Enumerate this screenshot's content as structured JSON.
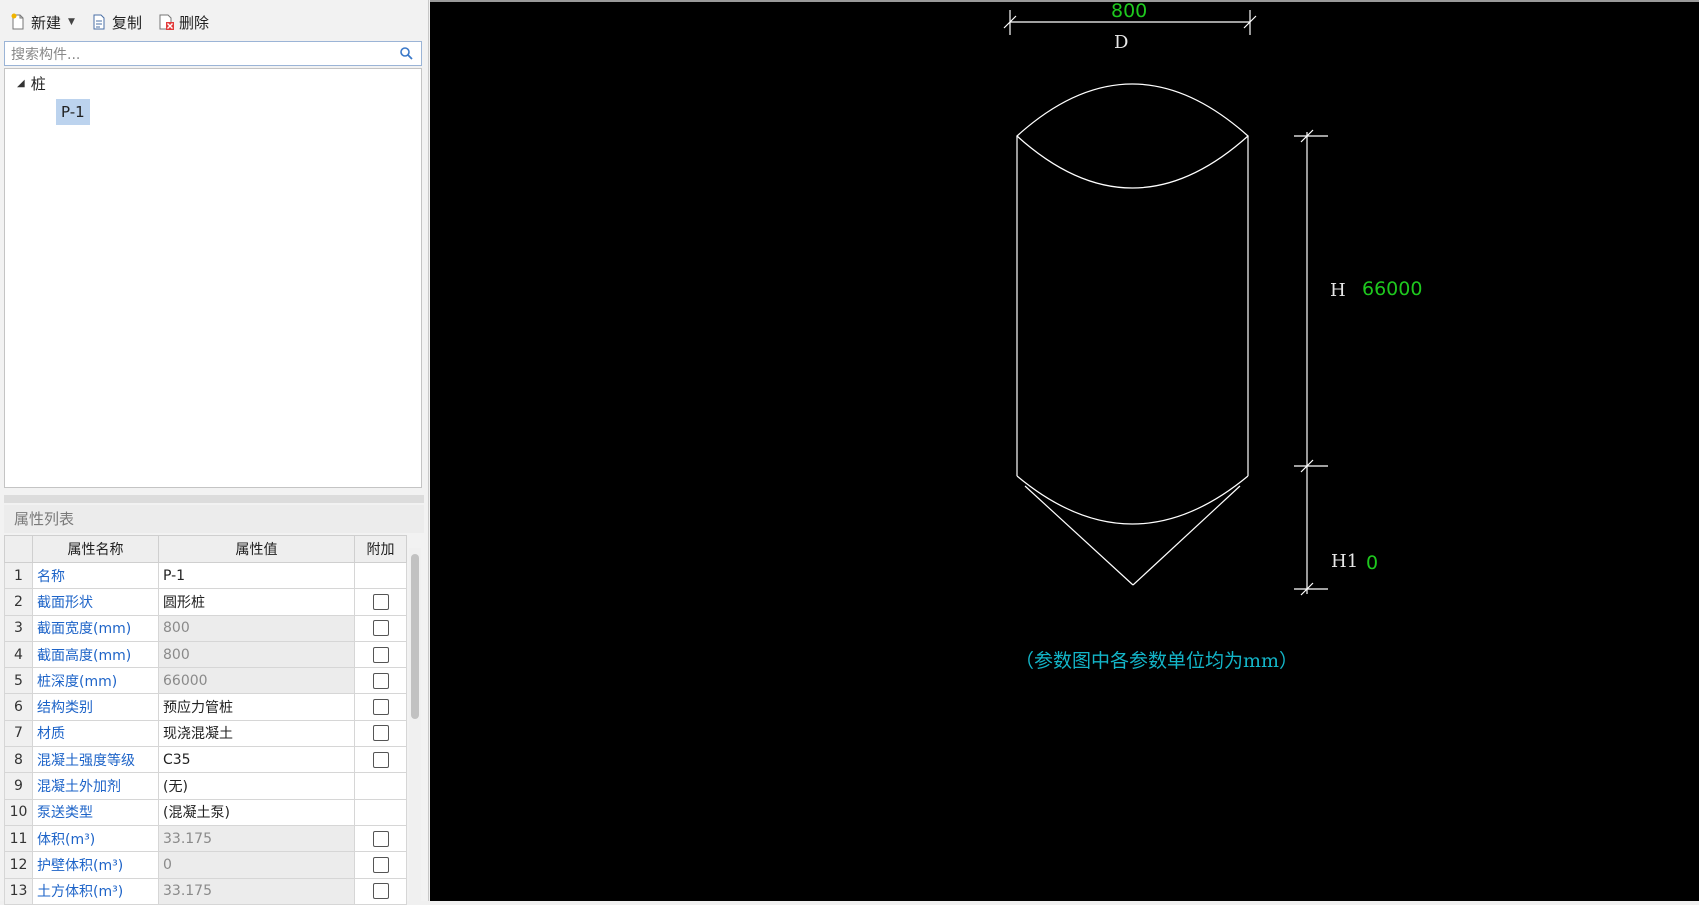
{
  "toolbar": {
    "new_label": "新建",
    "copy_label": "复制",
    "delete_label": "删除"
  },
  "search": {
    "placeholder": "搜索构件..."
  },
  "tree": {
    "root_label": "桩",
    "child_label": "P-1"
  },
  "properties": {
    "title": "属性列表",
    "columns": [
      "",
      "属性名称",
      "属性值",
      "附加"
    ],
    "rows": [
      {
        "index": "1",
        "name": "名称",
        "value": "P-1",
        "editable": true,
        "has_checkbox": false
      },
      {
        "index": "2",
        "name": "截面形状",
        "value": "圆形桩",
        "editable": true,
        "has_checkbox": true
      },
      {
        "index": "3",
        "name": "截面宽度(mm)",
        "value": "800",
        "editable": false,
        "has_checkbox": true
      },
      {
        "index": "4",
        "name": "截面高度(mm)",
        "value": "800",
        "editable": false,
        "has_checkbox": true
      },
      {
        "index": "5",
        "name": "桩深度(mm)",
        "value": "66000",
        "editable": false,
        "has_checkbox": true
      },
      {
        "index": "6",
        "name": "结构类别",
        "value": "预应力管桩",
        "editable": true,
        "has_checkbox": true
      },
      {
        "index": "7",
        "name": "材质",
        "value": "现浇混凝土",
        "editable": true,
        "has_checkbox": true
      },
      {
        "index": "8",
        "name": "混凝土强度等级",
        "value": "C35",
        "editable": true,
        "has_checkbox": true
      },
      {
        "index": "9",
        "name": "混凝土外加剂",
        "value": "(无)",
        "editable": true,
        "has_checkbox": false
      },
      {
        "index": "10",
        "name": "泵送类型",
        "value": "(混凝土泵)",
        "editable": true,
        "has_checkbox": false
      },
      {
        "index": "11",
        "name": "体积(m³)",
        "value": "33.175",
        "editable": false,
        "has_checkbox": true
      },
      {
        "index": "12",
        "name": "护壁体积(m³)",
        "value": "0",
        "editable": false,
        "has_checkbox": true
      },
      {
        "index": "13",
        "name": "土方体积(m³)",
        "value": "33.175",
        "editable": false,
        "has_checkbox": true
      }
    ]
  },
  "drawing": {
    "width_value": "800",
    "width_label": "D",
    "height_label": "H",
    "height_value": "66000",
    "tip_label": "H1",
    "tip_value": "0",
    "note": "（参数图中各参数单位均为mm）",
    "colors": {
      "line": "#ffffff",
      "value": "#1ec81e",
      "note": "#13b5c8",
      "background": "#000000"
    }
  }
}
